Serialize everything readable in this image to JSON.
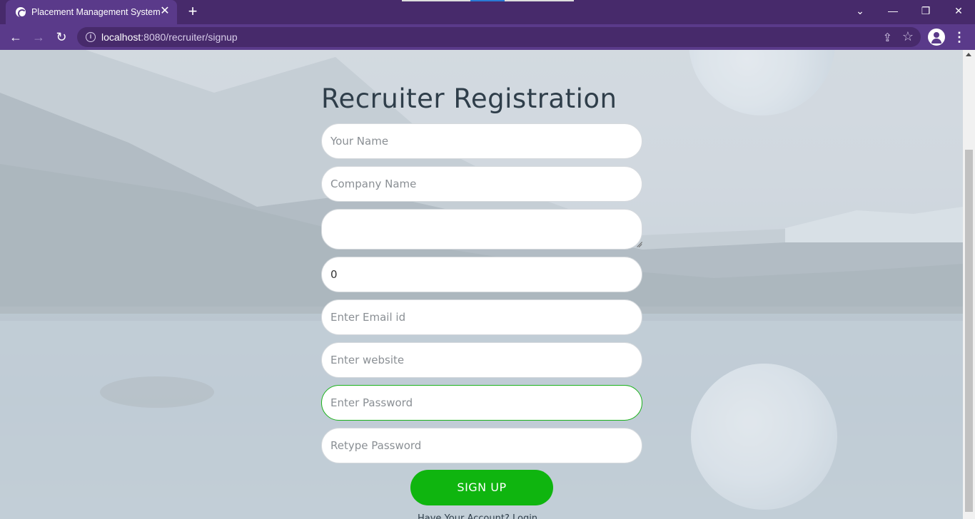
{
  "browser": {
    "tab_title": "Placement Management System",
    "tab_close": "✕",
    "new_tab": "+",
    "url_host": "localhost",
    "url_path": ":8080/recruiter/signup",
    "window_controls": {
      "minimize": "—",
      "restore": "❐",
      "close": "✕",
      "tab_search": "⌄"
    }
  },
  "form": {
    "title": "Recruiter Registration",
    "name_placeholder": "Your Name",
    "company_placeholder": "Company Name",
    "address_value": "",
    "phone_value": "0",
    "email_placeholder": "Enter Email id",
    "website_placeholder": "Enter website",
    "password_placeholder": "Enter Password",
    "retype_placeholder": "Retype Password",
    "submit_label": "SIGN UP",
    "footer_text": "Have Your Account? Login"
  },
  "colors": {
    "browser_frame": "#472a6b",
    "toolbar": "#5a3a8a",
    "accent_green": "#0fb50f",
    "focus_border": "#1bb21b"
  }
}
